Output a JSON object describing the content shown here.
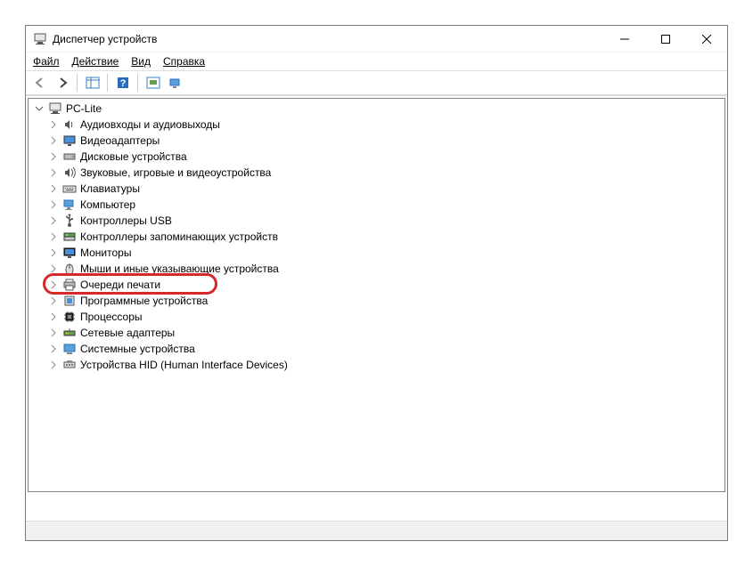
{
  "window": {
    "title": "Диспетчер устройств"
  },
  "menu": {
    "file": "Файл",
    "action": "Действие",
    "view": "Вид",
    "help": "Справка"
  },
  "tree": {
    "root": "PC-Lite",
    "items": [
      {
        "label": "Аудиовходы и аудиовыходы",
        "icon": "audio"
      },
      {
        "label": "Видеоадаптеры",
        "icon": "display"
      },
      {
        "label": "Дисковые устройства",
        "icon": "disk"
      },
      {
        "label": "Звуковые, игровые и видеоустройства",
        "icon": "sound"
      },
      {
        "label": "Клавиатуры",
        "icon": "keyboard"
      },
      {
        "label": "Компьютер",
        "icon": "computer"
      },
      {
        "label": "Контроллеры USB",
        "icon": "usb"
      },
      {
        "label": "Контроллеры запоминающих устройств",
        "icon": "storage"
      },
      {
        "label": "Мониторы",
        "icon": "monitor"
      },
      {
        "label": "Мыши и иные указывающие устройства",
        "icon": "mouse"
      },
      {
        "label": "Очереди печати",
        "icon": "printer",
        "highlight": true
      },
      {
        "label": "Программные устройства",
        "icon": "software"
      },
      {
        "label": "Процессоры",
        "icon": "cpu"
      },
      {
        "label": "Сетевые адаптеры",
        "icon": "network"
      },
      {
        "label": "Системные устройства",
        "icon": "system"
      },
      {
        "label": "Устройства HID (Human Interface Devices)",
        "icon": "hid"
      }
    ]
  }
}
